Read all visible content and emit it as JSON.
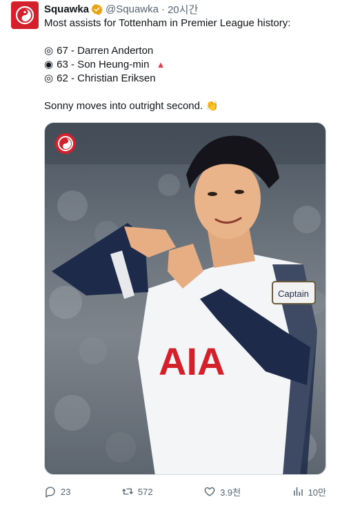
{
  "author": {
    "name": "Squawka",
    "handle": "@Squawka",
    "separator": "·",
    "time": "20시간"
  },
  "tweet": {
    "intro": "Most assists for Tottenham in Premier League history:",
    "list": [
      {
        "rank_icon": "◎",
        "text": "67 - Darren Anderton"
      },
      {
        "rank_icon": "◉",
        "text": "63 - Son Heung-min",
        "trend": "▲"
      },
      {
        "rank_icon": "◎",
        "text": "62 - Christian Eriksen"
      }
    ],
    "closing": "Sonny moves into outright second.",
    "closing_emoji": "👏"
  },
  "media": {
    "shirt_sponsor": "AIA",
    "armband_text": "Captain"
  },
  "actions": {
    "replies": "23",
    "reposts": "572",
    "likes": "3.9천",
    "views": "10만"
  },
  "colors": {
    "brand_red": "#d3202a",
    "verified_gold": "#e8a317",
    "muted": "#536471",
    "trend_up": "#d9434f"
  },
  "icons": {
    "avatar": "squawka-logo-icon",
    "verified": "verified-badge-icon",
    "more": "more-dots-icon",
    "reply": "reply-icon",
    "repost": "repost-icon",
    "like": "heart-icon",
    "views": "views-chart-icon"
  }
}
